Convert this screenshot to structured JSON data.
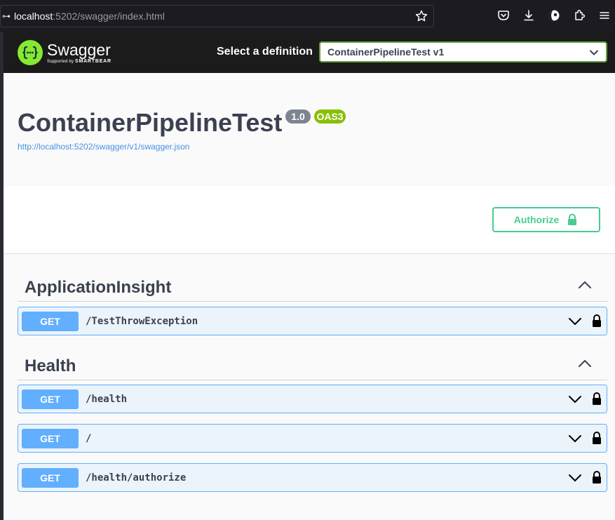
{
  "browser": {
    "url_host": "localhost",
    "url_rest": ":5202/swagger/index.html",
    "url_prefix_icon": "site-info-icon",
    "icons": [
      "bookmark-star-icon",
      "pocket-icon",
      "downloads-icon",
      "account-icon",
      "extensions-icon",
      "menu-icon"
    ]
  },
  "topbar": {
    "logo_text": "Swagger",
    "logo_sub_prefix": "Supported by ",
    "logo_sub_brand": "SMARTBEAR",
    "select_label": "Select a definition",
    "select_value": "ContainerPipelineTest v1"
  },
  "info": {
    "title": "ContainerPipelineTest",
    "version": "1.0",
    "oas": "OAS3",
    "spec_url": "http://localhost:5202/swagger/v1/swagger.json"
  },
  "scheme": {
    "authorize_label": "Authorize"
  },
  "tags": [
    {
      "name": "ApplicationInsight",
      "operations": [
        {
          "method": "GET",
          "path": "/TestThrowException"
        }
      ]
    },
    {
      "name": "Health",
      "operations": [
        {
          "method": "GET",
          "path": "/health"
        },
        {
          "method": "GET",
          "path": "/"
        },
        {
          "method": "GET",
          "path": "/health/authorize"
        }
      ]
    }
  ],
  "colors": {
    "get": "#61affe",
    "get_bg": "#ebf3fb",
    "authorize": "#49cc90",
    "swagger_green": "#85ea2d",
    "oas_badge": "#89bf04",
    "version_badge": "#7d8492"
  }
}
